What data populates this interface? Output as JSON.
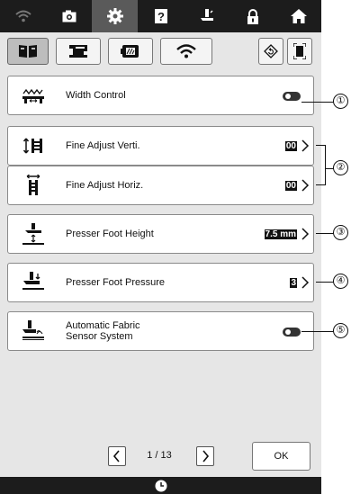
{
  "toolbar": {
    "buttons": [
      {
        "icon": "wifi-icon"
      },
      {
        "icon": "camera-icon"
      },
      {
        "icon": "gear-icon",
        "active": true
      },
      {
        "icon": "help-icon"
      },
      {
        "icon": "presser-foot-icon"
      },
      {
        "icon": "lock-icon"
      },
      {
        "icon": "home-icon"
      }
    ]
  },
  "tabs": [
    {
      "icon": "book-settings-icon",
      "active": true
    },
    {
      "icon": "sewing-machine-icon"
    },
    {
      "icon": "embroidery-frame-icon"
    },
    {
      "icon": "wifi-icon"
    },
    {
      "icon": "reset-icon"
    },
    {
      "icon": "screen-capture-icon"
    }
  ],
  "settings": {
    "width_control": {
      "label": "Width Control",
      "icon": "width-control-icon",
      "toggle": "off"
    },
    "fine_adjust_verti": {
      "label": "Fine Adjust Verti.",
      "icon": "fine-adjust-vertical-icon",
      "value": "00"
    },
    "fine_adjust_horiz": {
      "label": "Fine Adjust Horiz.",
      "icon": "fine-adjust-horizontal-icon",
      "value": "00"
    },
    "presser_foot_height": {
      "label": "Presser Foot Height",
      "icon": "presser-foot-height-icon",
      "value": "7.5 mm"
    },
    "presser_foot_pressure": {
      "label": "Presser Foot Pressure",
      "icon": "presser-foot-pressure-icon",
      "value": "3"
    },
    "auto_fabric_sensor": {
      "label_line1": "Automatic Fabric",
      "label_line2": "Sensor System",
      "icon": "fabric-sensor-icon",
      "toggle": "off"
    }
  },
  "callouts": [
    "①",
    "②",
    "③",
    "④",
    "⑤"
  ],
  "pager": {
    "text": "1 / 13",
    "ok_label": "OK"
  },
  "status": {
    "icon": "clock-icon"
  }
}
